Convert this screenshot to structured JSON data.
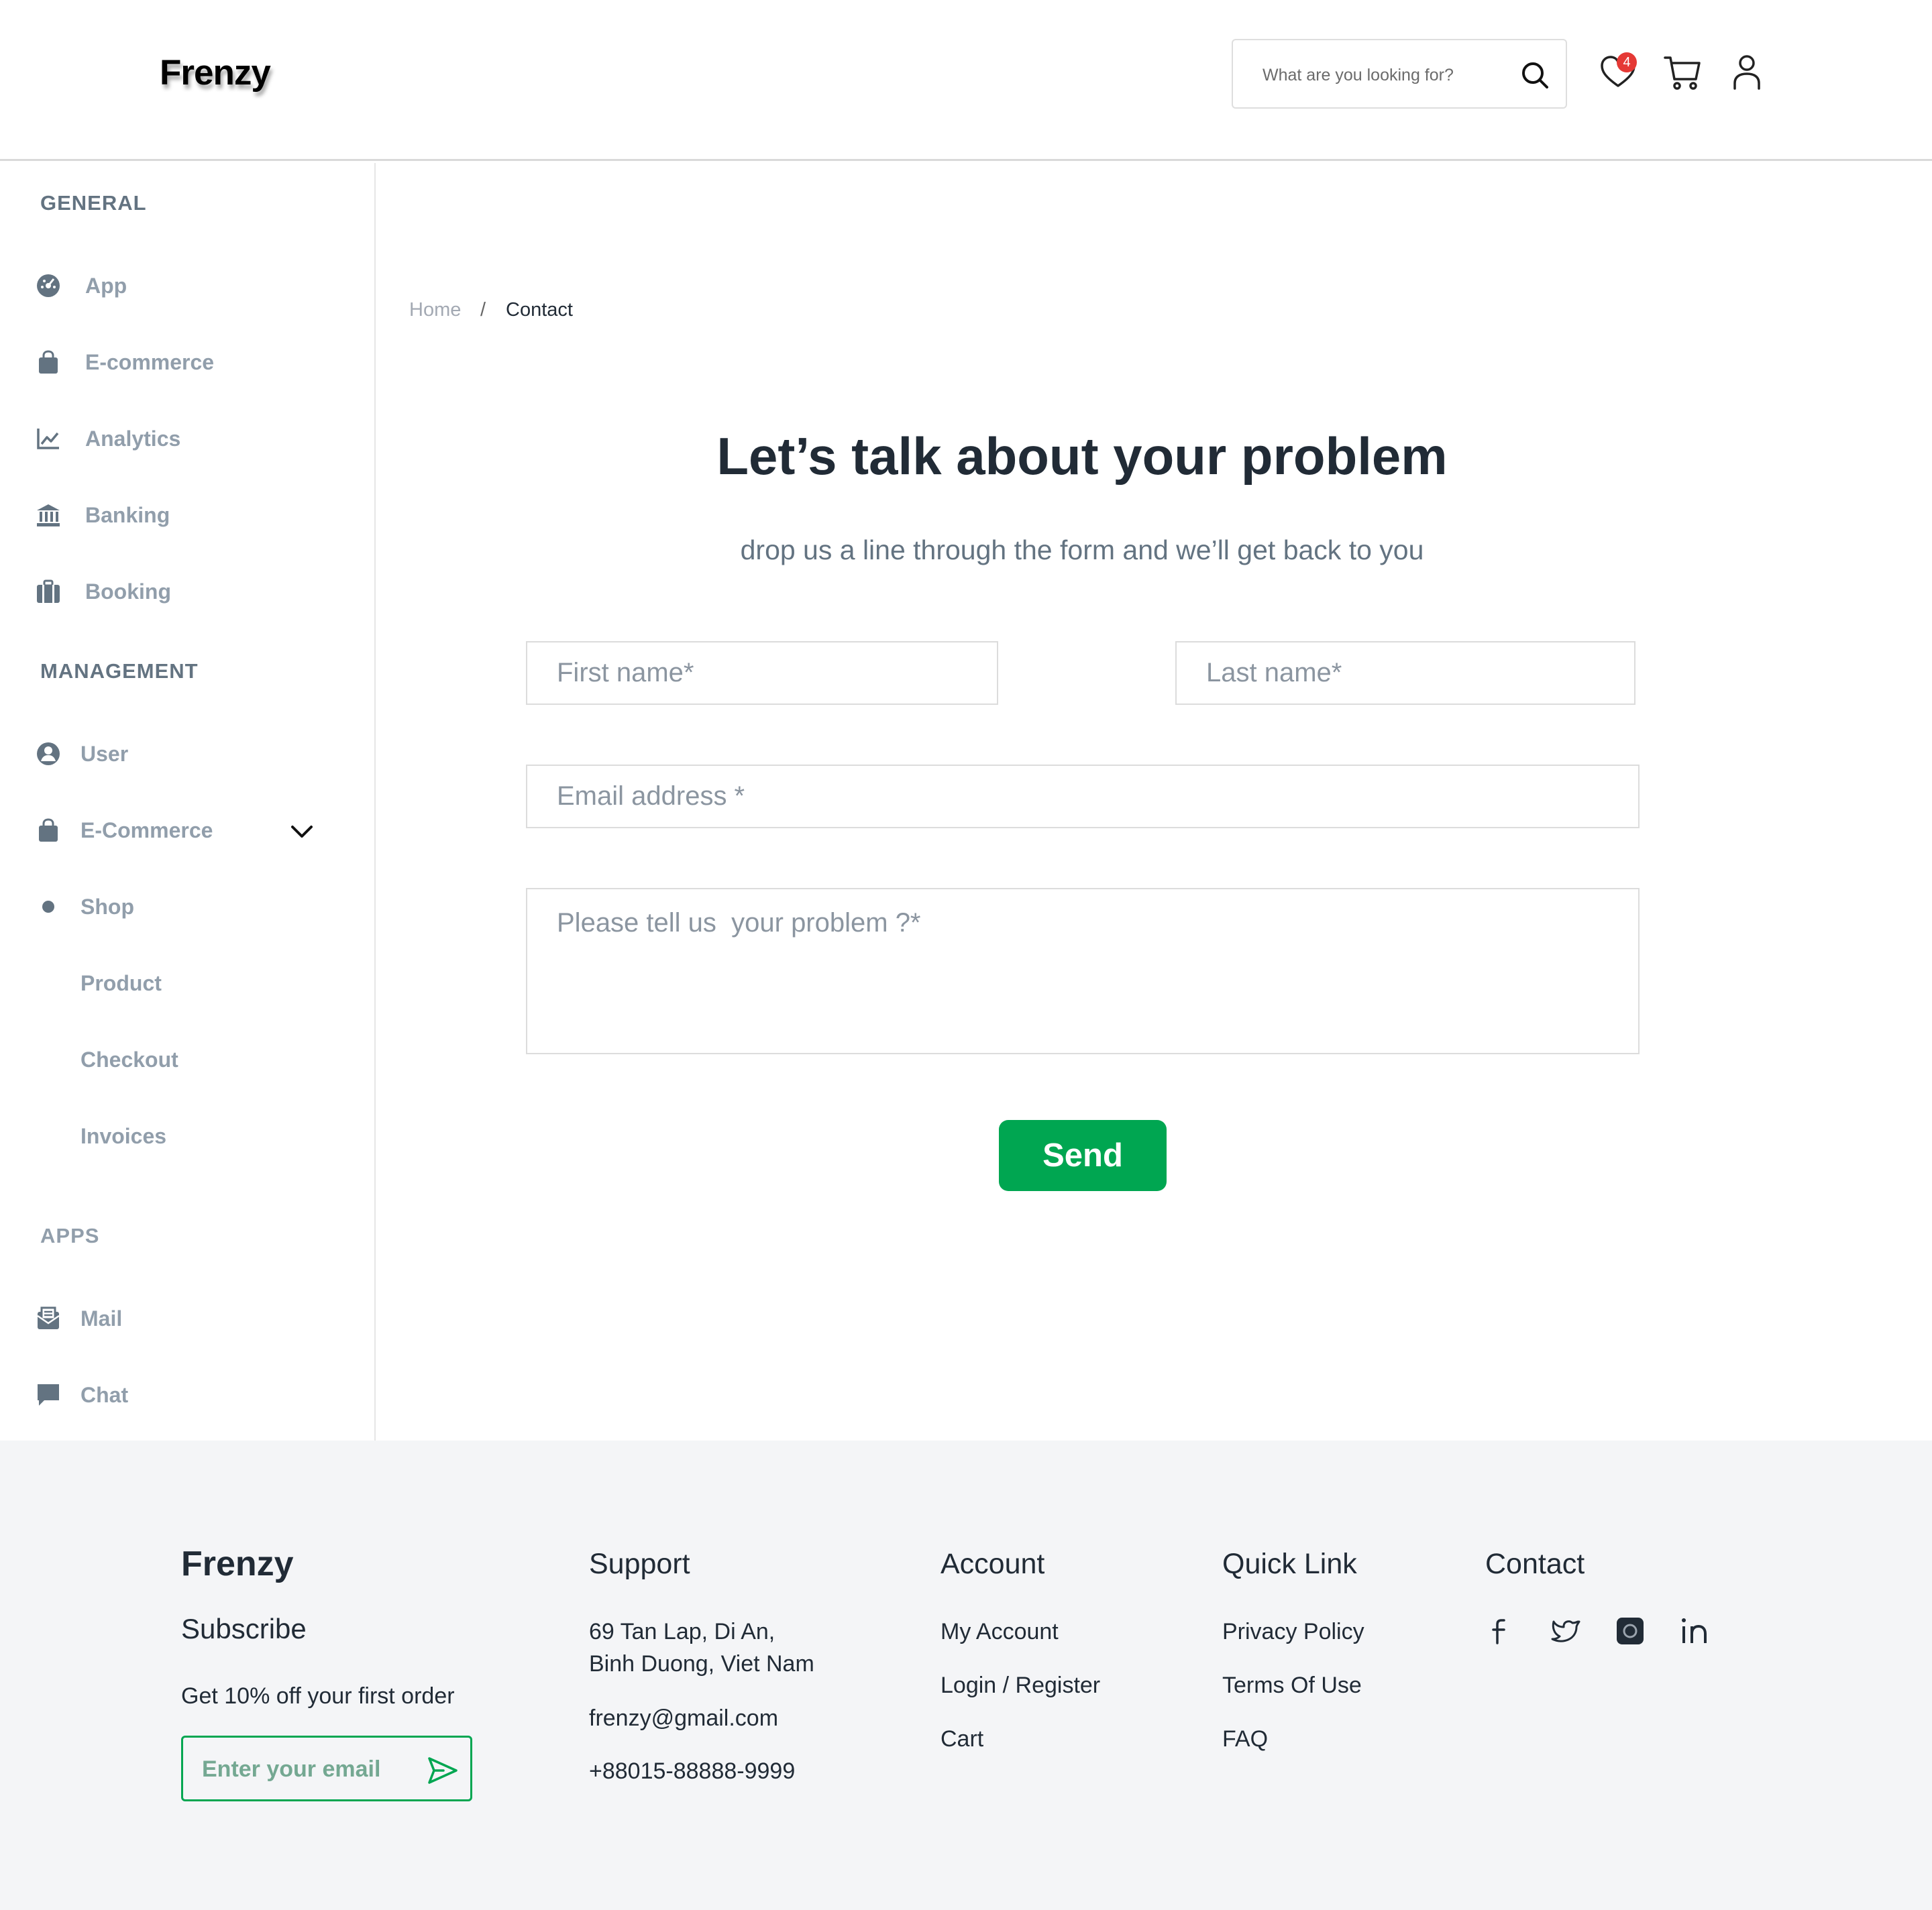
{
  "header": {
    "logo": "Frenzy",
    "search_placeholder": "What are you looking for?",
    "wishlist_count": "4",
    "icons": [
      "search-icon",
      "heart-icon",
      "cart-icon",
      "user-icon"
    ]
  },
  "sidebar": {
    "general_title": "GENERAL",
    "general_items": [
      {
        "label": "App",
        "icon": "dashboard-icon"
      },
      {
        "label": "E-commerce",
        "icon": "bag-icon"
      },
      {
        "label": "Analytics",
        "icon": "chart-icon"
      },
      {
        "label": "Banking",
        "icon": "bank-icon"
      },
      {
        "label": "Booking",
        "icon": "luggage-icon"
      }
    ],
    "management_title": "MANAGEMENT",
    "management_items": [
      {
        "label": "User",
        "icon": "user-circle-icon"
      },
      {
        "label": "E-Commerce",
        "icon": "bag-icon"
      },
      {
        "label": "Shop",
        "icon": "dot-icon"
      },
      {
        "label": "Product"
      },
      {
        "label": "Checkout"
      },
      {
        "label": "Invoices"
      }
    ],
    "apps_title": "APPS",
    "apps_items": [
      {
        "label": "Mail",
        "icon": "mail-icon"
      },
      {
        "label": "Chat",
        "icon": "chat-icon"
      }
    ]
  },
  "breadcrumb": {
    "home": "Home",
    "separator": "/",
    "current": "Contact"
  },
  "contact": {
    "title": "Let’s talk about your problem",
    "subtitle": "drop us a line through the form  and we’ll get back to you",
    "first_name_placeholder": "First name*",
    "last_name_placeholder": "Last name*",
    "email_placeholder": "Email address *",
    "problem_placeholder": "Please tell us  your problem ?*",
    "send_label": "Send"
  },
  "footer": {
    "brand": "Frenzy",
    "subscribe_title": "Subscribe",
    "subscribe_text": "Get 10% off your first order",
    "email_placeholder": "Enter your email",
    "support_title": "Support",
    "address_line1": "69 Tan Lap, Di An,",
    "address_line2": "Binh Duong, Viet Nam",
    "email": "frenzy@gmail.com",
    "phone": "+88015-88888-9999",
    "account_title": "Account",
    "account_links": [
      "My Account",
      "Login / Register",
      "Cart"
    ],
    "quicklink_title": "Quick Link",
    "quick_links": [
      "Privacy Policy",
      "Terms Of Use",
      "FAQ"
    ],
    "contact_title": "Contact",
    "social_icons": [
      "facebook-icon",
      "twitter-icon",
      "instagram-icon",
      "linkedin-icon"
    ]
  },
  "colors": {
    "accent": "#00a651",
    "badge": "#e53935",
    "muted": "#919eab",
    "text": "#212b36",
    "footer_bg": "#f4f5f7"
  }
}
